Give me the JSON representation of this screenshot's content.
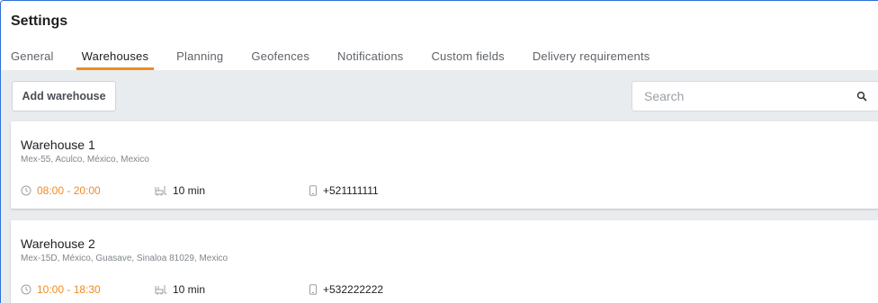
{
  "header": {
    "title": "Settings",
    "tabs": [
      {
        "label": "General"
      },
      {
        "label": "Warehouses"
      },
      {
        "label": "Planning"
      },
      {
        "label": "Geofences"
      },
      {
        "label": "Notifications"
      },
      {
        "label": "Custom fields"
      },
      {
        "label": "Delivery requirements"
      }
    ],
    "active_tab": "Warehouses"
  },
  "toolbar": {
    "add_label": "Add warehouse",
    "search_placeholder": "Search",
    "search_value": ""
  },
  "warehouses": [
    {
      "name": "Warehouse 1",
      "address": "Mex-55, Aculco, México, Mexico",
      "hours": "08:00 - 20:00",
      "duration": "10 min",
      "phone": "+521111111"
    },
    {
      "name": "Warehouse 2",
      "address": "Mex-15D, México, Guasave, Sinaloa 81029, Mexico",
      "hours": "10:00 - 18:30",
      "duration": "10 min",
      "phone": "+532222222"
    }
  ],
  "colors": {
    "accent": "#f08a24",
    "background": "#e9ecef",
    "frame": "#2f6fd6"
  },
  "icons": {
    "hours": "clock-icon",
    "duration": "forklift-icon",
    "phone": "phone-icon",
    "search": "search-icon"
  }
}
